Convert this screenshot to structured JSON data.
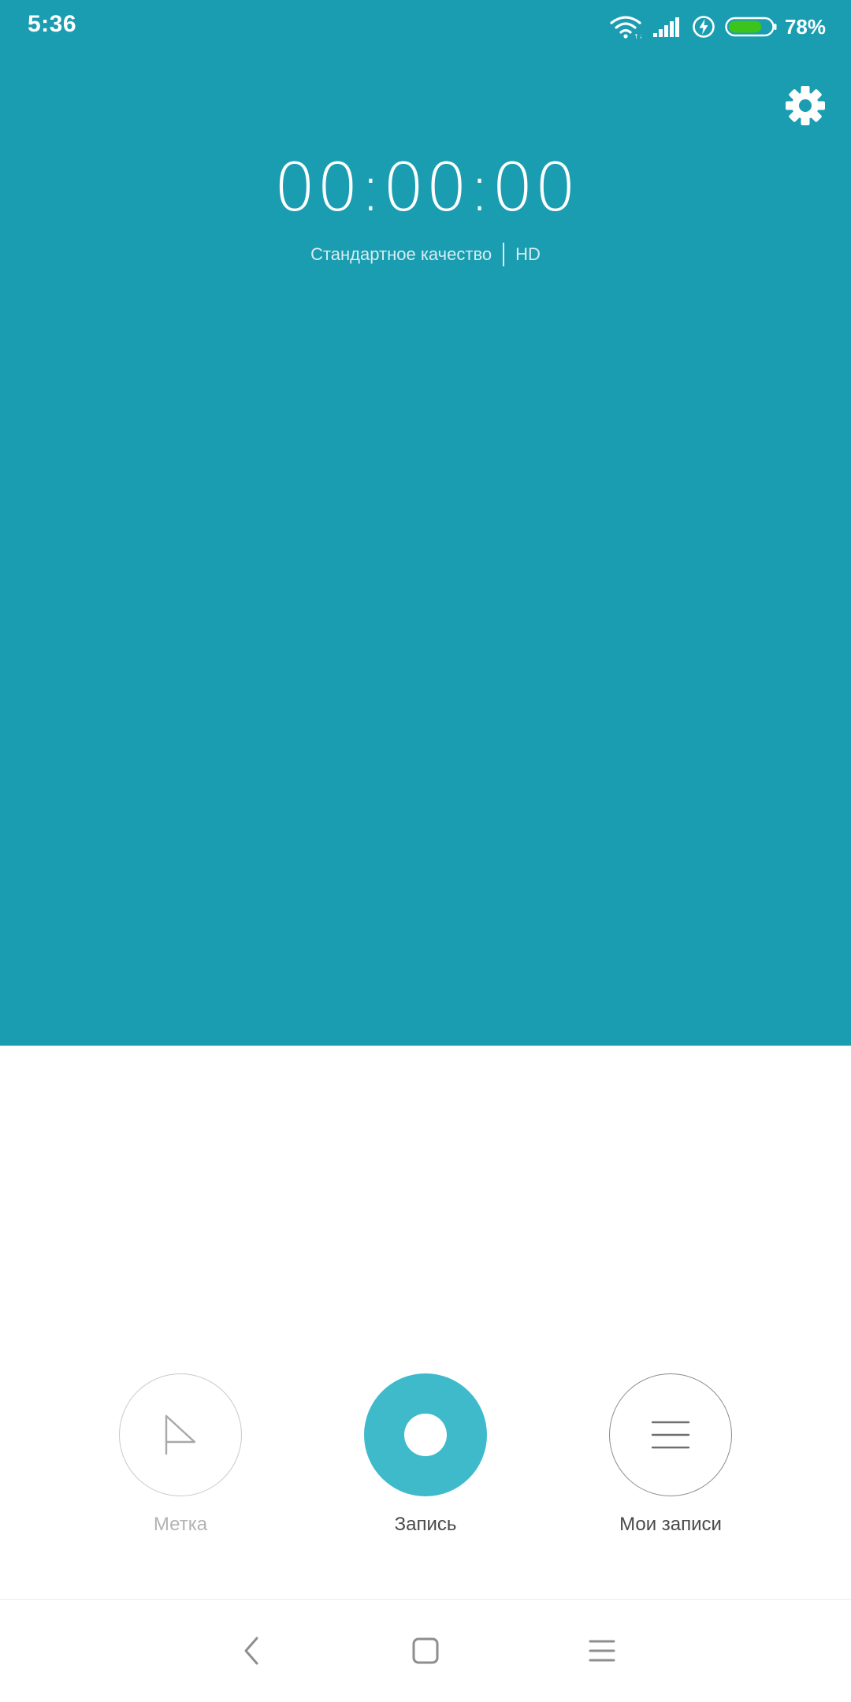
{
  "status_bar": {
    "time": "5:36",
    "battery_percent": "78%",
    "battery_level": 0.78,
    "battery_color": "#3cc31c",
    "icons": [
      "wifi-icon",
      "signal-icon",
      "charging-icon",
      "battery-icon"
    ]
  },
  "colors": {
    "top_background": "#1a9db1",
    "record_accent": "#3ebacb"
  },
  "recorder": {
    "timer": "00:00:00",
    "quality_standard": "Стандартное качество",
    "quality_hd": "HD"
  },
  "controls": {
    "mark_label": "Метка",
    "record_label": "Запись",
    "recordings_label": "Мои записи"
  },
  "icons": {
    "settings": "gear-icon",
    "mark": "flag-icon",
    "record": "record-dot-icon",
    "recordings": "list-icon",
    "nav_back": "chevron-left-icon",
    "nav_home": "square-icon",
    "nav_menu": "hamburger-icon"
  }
}
